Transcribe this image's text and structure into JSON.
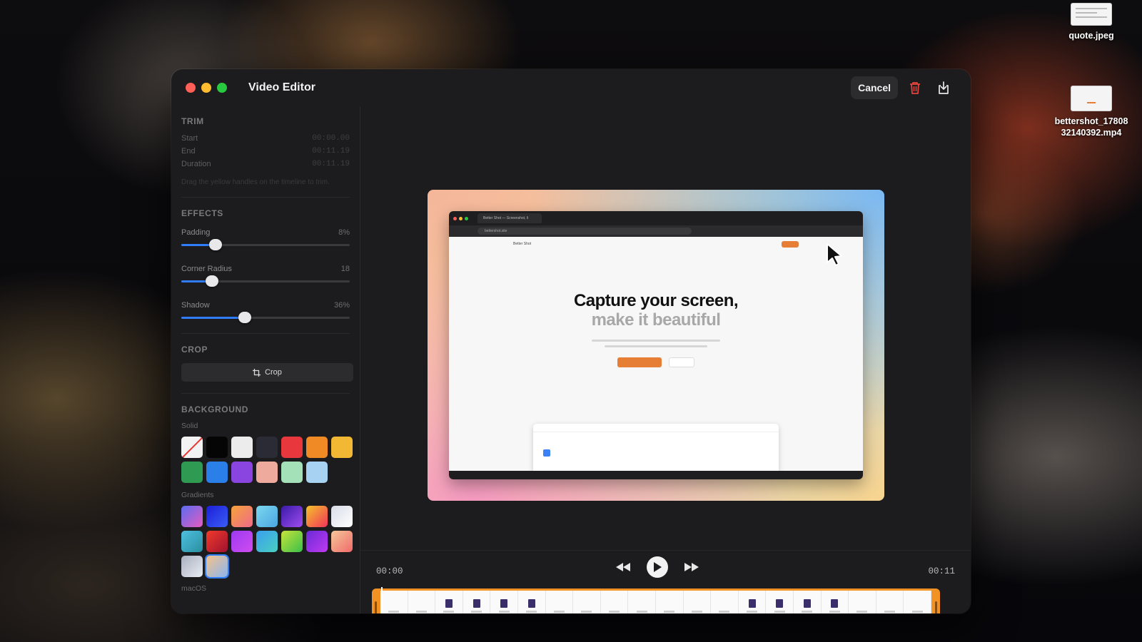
{
  "desktop": {
    "files": [
      {
        "name": "quote.jpeg"
      },
      {
        "name": "bettershot_17808\n32140392.mp4"
      }
    ]
  },
  "window": {
    "title": "Video Editor",
    "cancel_label": "Cancel",
    "delete_icon": "trash-icon",
    "export_icon": "download-icon"
  },
  "sidebar": {
    "trim": {
      "title": "TRIM",
      "rows": [
        {
          "label": "Start",
          "value": "00:00.00"
        },
        {
          "label": "End",
          "value": "00:11.19"
        },
        {
          "label": "Duration",
          "value": "00:11.19"
        }
      ],
      "help": "Drag the yellow handles on the timeline to trim."
    },
    "effects": {
      "title": "EFFECTS",
      "sliders": [
        {
          "label": "Padding",
          "value": "8%",
          "level": 0.2
        },
        {
          "label": "Corner Radius",
          "value": "18",
          "level": 0.18
        },
        {
          "label": "Shadow",
          "value": "36%",
          "level": 0.37
        }
      ]
    },
    "crop": {
      "title": "CROP",
      "button_label": "Crop"
    },
    "background": {
      "title": "BACKGROUND",
      "solid_label": "Solid",
      "solid_colors": [
        "none",
        "#050505",
        "#ececec",
        "#2b2b35",
        "#e8373d",
        "#f08a24",
        "#f2b833",
        "#2e9a52",
        "#2a7fe8",
        "#8a44e0",
        "#eeaa9c",
        "#a4e0b8",
        "#a8d2f2"
      ],
      "gradients_label": "Gradients",
      "gradients": [
        [
          "#5b6cf0",
          "#e45cc0"
        ],
        [
          "#1a1fd8",
          "#3b5cf5"
        ],
        [
          "#f5a33a",
          "#f06b8a"
        ],
        [
          "#7cd7f0",
          "#4aa6e0"
        ],
        [
          "#3a1aa8",
          "#a04cf0"
        ],
        [
          "#f5c32a",
          "#f0345a"
        ],
        [
          "#d8dde8",
          "#ffffff"
        ],
        [
          "#4ec0e0",
          "#2a8fa0"
        ],
        [
          "#f03a2a",
          "#a01230"
        ],
        [
          "#9c3af0",
          "#d04cf0"
        ],
        [
          "#3a9ef0",
          "#4ad0c0"
        ],
        [
          "#c8e23a",
          "#3ac04a"
        ],
        [
          "#6a2ad8",
          "#c03af0"
        ],
        [
          "#f5c89a",
          "#f06a6a"
        ],
        [
          "#aab0c0",
          "#e8ecf2"
        ],
        [
          "#f5c28a",
          "#8ab6f0"
        ]
      ],
      "selected_gradient": 15,
      "macos_label": "macOS"
    }
  },
  "preview": {
    "tab_label": "Better Shot — Screenshot, li",
    "address": "bettershot.site",
    "brand": "Better Shot",
    "headline_1": "Capture your screen,",
    "headline_2": "make it beautiful"
  },
  "controls": {
    "current_time": "00:00",
    "total_time": "00:11",
    "rewind_icon": "rewind-icon",
    "play_icon": "play-icon",
    "forward_icon": "fast-forward-icon"
  },
  "timeline": {
    "frames": [
      0,
      0,
      1,
      1,
      1,
      1,
      0,
      0,
      0,
      0,
      0,
      0,
      0,
      1,
      1,
      1,
      1,
      0,
      0,
      0
    ]
  }
}
